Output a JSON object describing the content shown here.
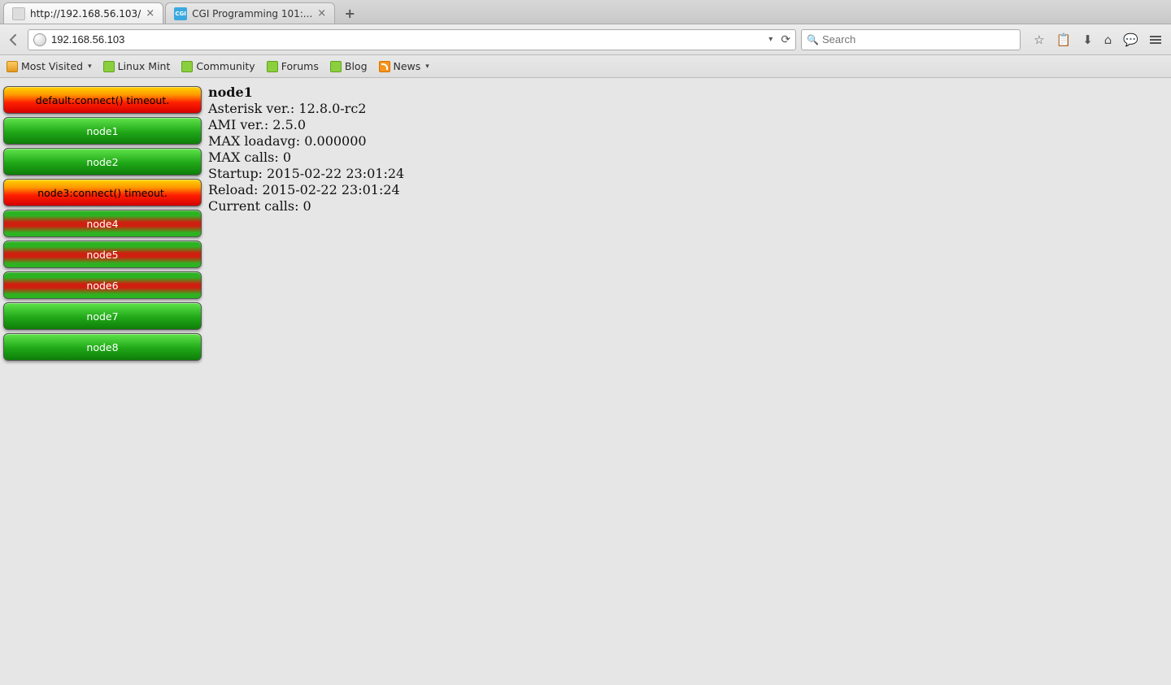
{
  "tabs": [
    {
      "title": "http://192.168.56.103/",
      "active": true,
      "favicon": "generic"
    },
    {
      "title": "CGI Programming 101:...",
      "active": false,
      "favicon": "cgi"
    }
  ],
  "url": "192.168.56.103",
  "search_placeholder": "Search",
  "bookmarks": [
    {
      "label": "Most Visited",
      "icon": "folder",
      "dropdown": true
    },
    {
      "label": "Linux Mint",
      "icon": "mint",
      "dropdown": false
    },
    {
      "label": "Community",
      "icon": "mint",
      "dropdown": false
    },
    {
      "label": "Forums",
      "icon": "mint",
      "dropdown": false
    },
    {
      "label": "Blog",
      "icon": "mint",
      "dropdown": false
    },
    {
      "label": "News",
      "icon": "rss",
      "dropdown": true
    }
  ],
  "nodes": [
    {
      "label": "default:connect() timeout.",
      "style": "error"
    },
    {
      "label": "node1",
      "style": "green"
    },
    {
      "label": "node2",
      "style": "green"
    },
    {
      "label": "node3:connect() timeout.",
      "style": "error"
    },
    {
      "label": "node4",
      "style": "mixed"
    },
    {
      "label": "node5",
      "style": "mixed"
    },
    {
      "label": "node6",
      "style": "mixed"
    },
    {
      "label": "node7",
      "style": "green"
    },
    {
      "label": "node8",
      "style": "green"
    }
  ],
  "detail": {
    "title": "node1",
    "lines": [
      "Asterisk ver.: 12.8.0-rc2",
      "AMI ver.: 2.5.0",
      "MAX loadavg: 0.000000",
      "MAX calls: 0",
      "Startup: 2015-02-22 23:01:24",
      "Reload: 2015-02-22 23:01:24",
      "Current calls: 0"
    ]
  }
}
